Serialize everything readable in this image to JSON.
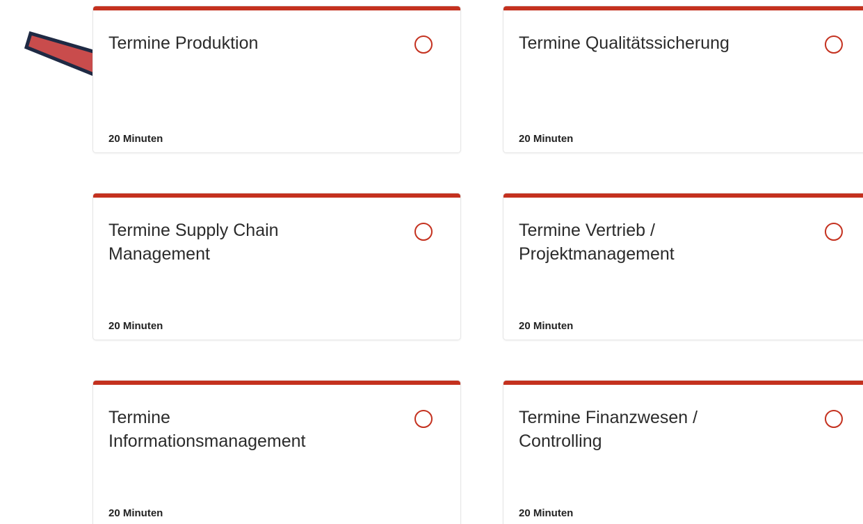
{
  "colors": {
    "accent": "#c4311f",
    "arrow_fill": "#c94c4c",
    "arrow_outline": "#1f2a44"
  },
  "cards": [
    {
      "title": "Termine Produktion",
      "duration": "20 Minuten"
    },
    {
      "title": "Termine Qualitätssicherung",
      "duration": "20 Minuten"
    },
    {
      "title": "Termine Supply Chain Management",
      "duration": "20 Minuten"
    },
    {
      "title": "Termine Vertrieb / Projektmanagement",
      "duration": "20 Minuten"
    },
    {
      "title": "Termine Informationsmanagement",
      "duration": "20 Minuten"
    },
    {
      "title": "Termine Finanzwesen / Controlling",
      "duration": "20 Minuten"
    }
  ],
  "annotation": {
    "icon": "arrow-right-icon"
  }
}
